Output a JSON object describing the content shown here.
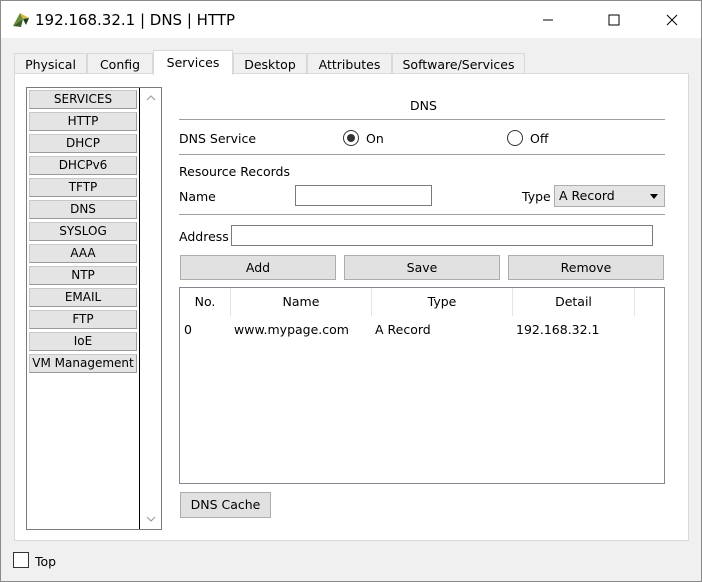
{
  "window": {
    "title": "192.168.32.1 | DNS | HTTP",
    "minimize_icon": "minimize-icon",
    "maximize_icon": "maximize-icon",
    "close_icon": "close-icon"
  },
  "tabs": [
    {
      "label": "Physical"
    },
    {
      "label": "Config"
    },
    {
      "label": "Services",
      "active": true
    },
    {
      "label": "Desktop"
    },
    {
      "label": "Attributes"
    },
    {
      "label": "Software/Services"
    }
  ],
  "sidebar": {
    "items": [
      {
        "label": "SERVICES"
      },
      {
        "label": "HTTP"
      },
      {
        "label": "DHCP"
      },
      {
        "label": "DHCPv6"
      },
      {
        "label": "TFTP"
      },
      {
        "label": "DNS"
      },
      {
        "label": "SYSLOG"
      },
      {
        "label": "AAA"
      },
      {
        "label": "NTP"
      },
      {
        "label": "EMAIL"
      },
      {
        "label": "FTP"
      },
      {
        "label": "IoE"
      },
      {
        "label": "VM Management"
      }
    ]
  },
  "dns": {
    "heading": "DNS",
    "service_label": "DNS Service",
    "on_label": "On",
    "off_label": "Off",
    "service_state": "On",
    "resource_records_label": "Resource Records",
    "name_label": "Name",
    "name_value": "",
    "type_label": "Type",
    "type_value": "A Record",
    "address_label": "Address",
    "address_value": "",
    "add_button": "Add",
    "save_button": "Save",
    "remove_button": "Remove",
    "dns_cache_button": "DNS Cache"
  },
  "table": {
    "columns": [
      "No.",
      "Name",
      "Type",
      "Detail"
    ],
    "rows": [
      [
        "0",
        "www.mypage.com",
        "A Record",
        "192.168.32.1"
      ]
    ]
  },
  "footer": {
    "top_label": "Top",
    "top_checked": false
  }
}
